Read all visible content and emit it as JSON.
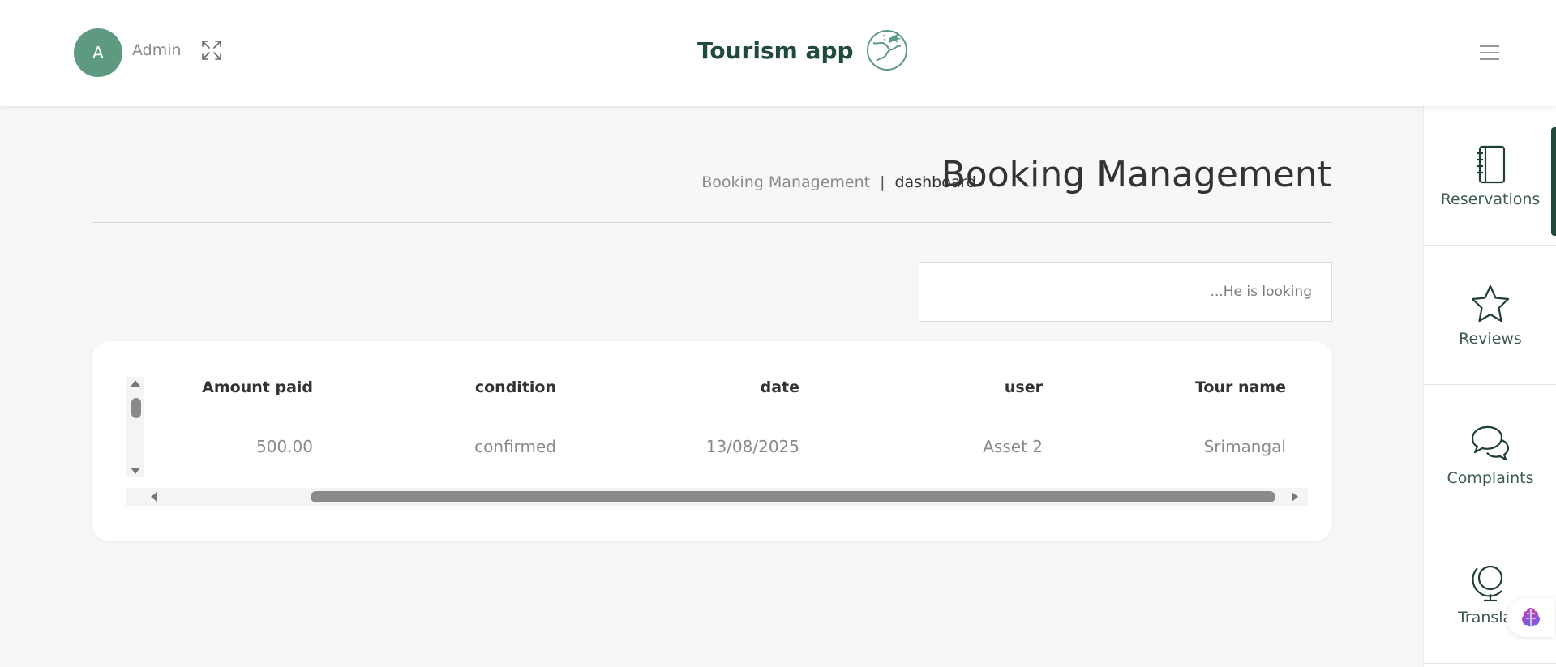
{
  "header": {
    "avatar_initial": "A",
    "user_name": "Admin",
    "brand_title": "Tourism app",
    "icons": {
      "expand": "expand-arrows-icon",
      "logo": "globe-airplane-icon",
      "menu": "hamburger-menu-icon"
    }
  },
  "sidebar": {
    "items": [
      {
        "label": "Reservations",
        "icon": "notebook-icon",
        "active": true
      },
      {
        "label": "Reviews",
        "icon": "star-icon",
        "active": false
      },
      {
        "label": "Complaints",
        "icon": "chat-bubbles-icon",
        "active": false
      },
      {
        "label": "Translati",
        "icon": "globe-stand-icon",
        "active": false
      }
    ],
    "assistant_icon": "brain-icon"
  },
  "main": {
    "title": "Booking Management",
    "breadcrumb": {
      "link": "Booking Management",
      "separator": "|",
      "current": "dashboard"
    },
    "search": {
      "placeholder": "...He is looking",
      "value": ""
    },
    "table": {
      "columns": [
        "Tour name",
        "user",
        "date",
        "condition",
        "Amount paid"
      ],
      "rows": [
        {
          "tour_name": "Srimangal",
          "user": "Asset 2",
          "date": "13/08/2025",
          "condition": "confirmed",
          "amount_paid": "500.00"
        }
      ]
    }
  },
  "colors": {
    "accent": "#1f4a3c",
    "avatar": "#5e9a80",
    "background": "#f7f7f7",
    "muted_text": "#8a8a8a"
  }
}
